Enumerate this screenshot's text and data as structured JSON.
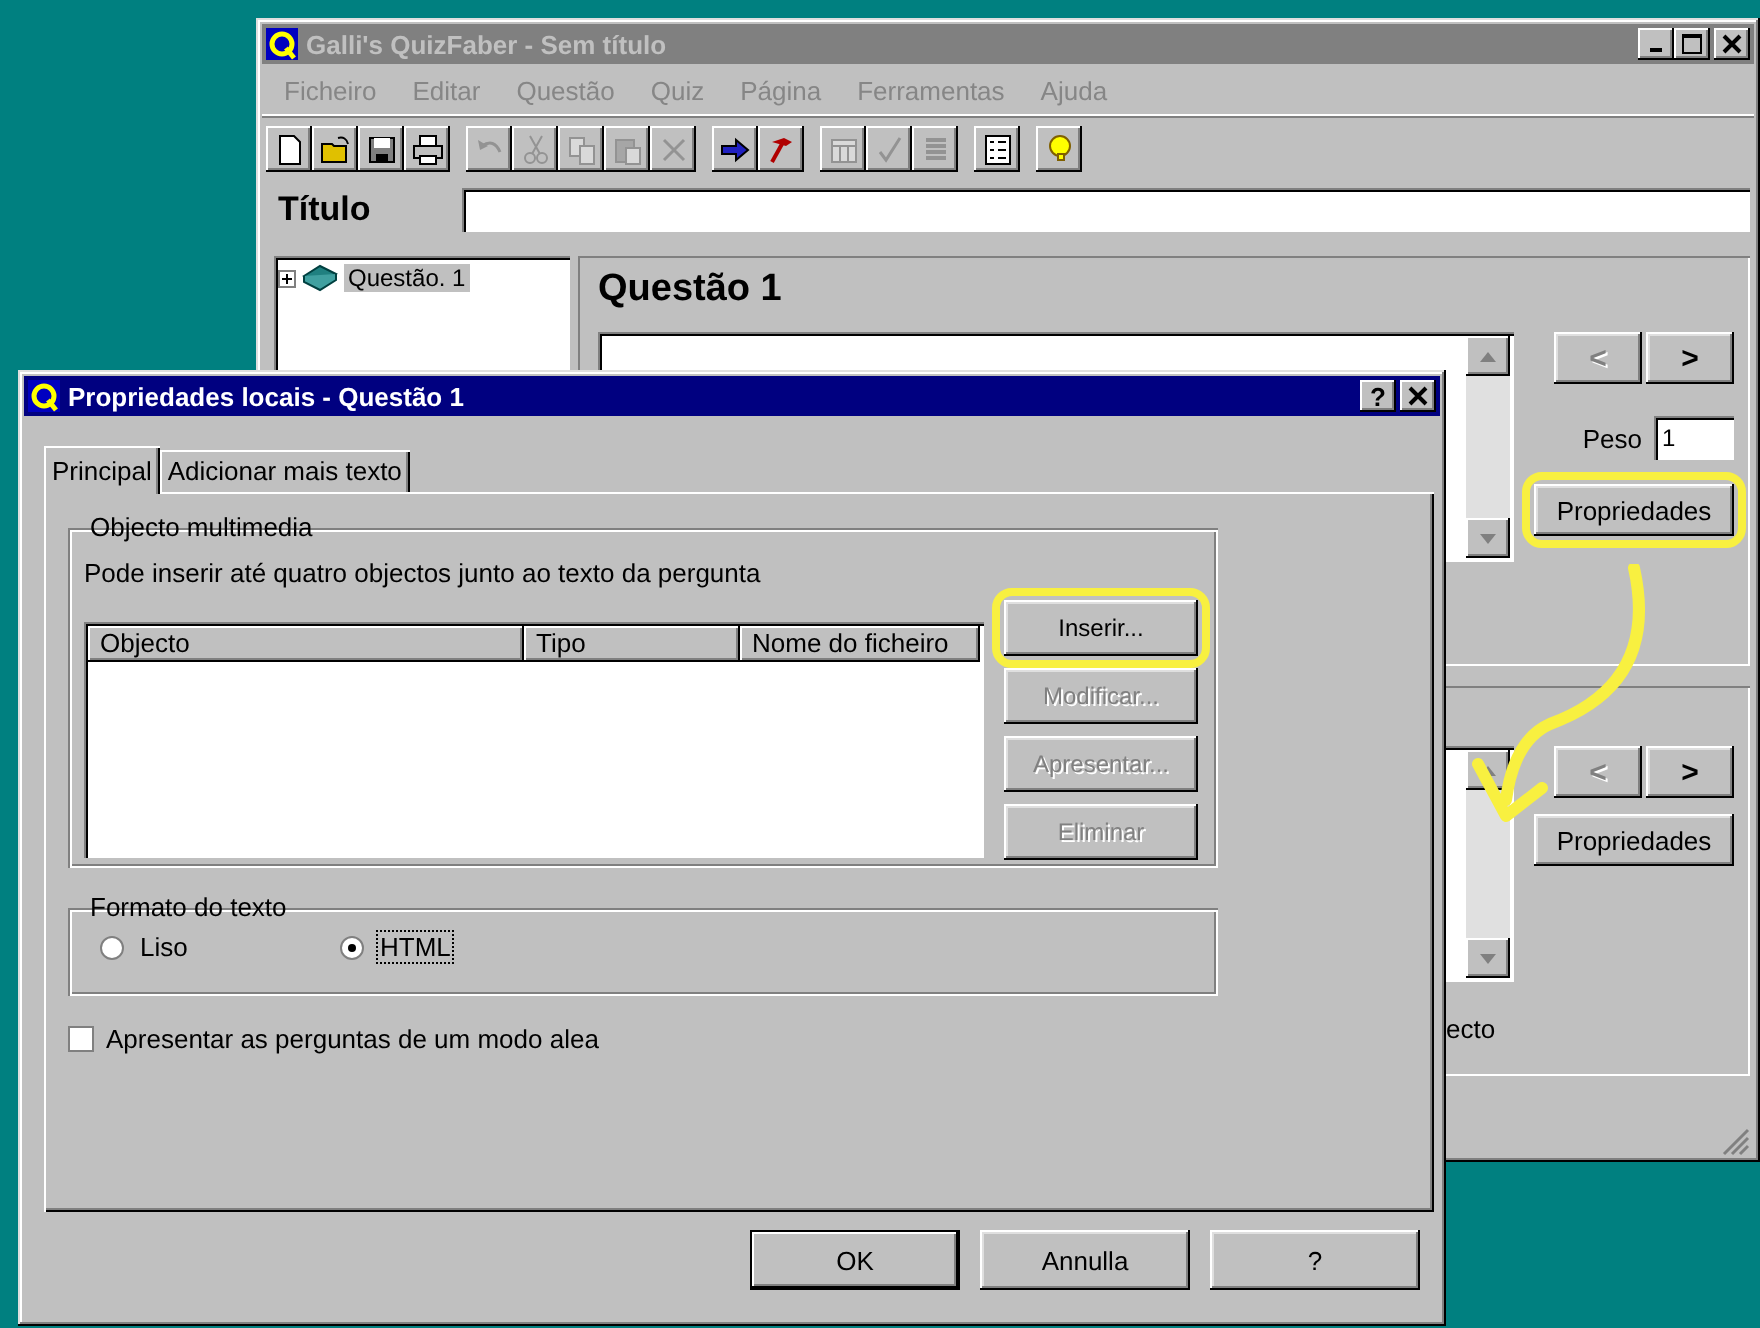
{
  "main_window": {
    "title": "Galli's QuizFaber - Sem título",
    "menu": [
      "Ficheiro",
      "Editar",
      "Questão",
      "Quiz",
      "Página",
      "Ferramentas",
      "Ajuda"
    ],
    "toolbar": [
      [
        {
          "disabled": false
        },
        {
          "disabled": false
        },
        {
          "disabled": false
        },
        {
          "disabled": false
        }
      ],
      [
        {
          "disabled": true
        },
        {
          "disabled": true
        },
        {
          "disabled": true
        },
        {
          "disabled": true
        },
        {
          "disabled": true
        }
      ],
      [
        {
          "disabled": false
        },
        {
          "disabled": false
        }
      ],
      [
        {
          "disabled": true
        },
        {
          "disabled": true
        },
        {
          "disabled": true
        }
      ],
      [
        {
          "disabled": false
        }
      ],
      [
        {
          "disabled": false
        }
      ]
    ],
    "title_label": "Título",
    "tree": [
      {
        "label": "Questão. 1",
        "selected": true,
        "expanded": false
      }
    ],
    "question_heading": "Questão 1",
    "nav_buttons": [
      {
        "label": "<",
        "disabled": true
      },
      {
        "label": ">",
        "disabled": false
      }
    ],
    "weight": {
      "label": "Peso",
      "value": "1"
    },
    "properties_button": {
      "label": "Propriedades",
      "highlighted": true
    },
    "lower_nav_buttons": [
      {
        "label": "<",
        "disabled": true
      },
      {
        "label": ">",
        "disabled": false
      }
    ],
    "lower_properties_button": {
      "label": "Propriedades",
      "highlighted": false
    },
    "lower_partial_text": "ecto"
  },
  "dialog": {
    "title": "Propriedades locais - Questão 1",
    "help_button": "?",
    "tabs": [
      {
        "label": "Principal",
        "selected": true
      },
      {
        "label": "Adicionar mais texto",
        "selected": false
      }
    ],
    "multimedia_group": {
      "legend": "Objecto multimedia",
      "hint": "Pode inserir até quatro objectos junto ao texto da pergunta",
      "columns": [
        "Objecto",
        "Tipo",
        "Nome do ficheiro"
      ],
      "buttons": [
        {
          "label": "Inserir...",
          "disabled": false,
          "highlighted": true
        },
        {
          "label": "Modificar...",
          "disabled": true,
          "highlighted": false
        },
        {
          "label": "Apresentar...",
          "disabled": true,
          "highlighted": false
        },
        {
          "label": "Eliminar",
          "disabled": true,
          "highlighted": false
        }
      ]
    },
    "format_group": {
      "legend": "Formato do texto",
      "options": [
        {
          "label": "Liso",
          "selected": false,
          "focused": false
        },
        {
          "label": "HTML",
          "selected": true,
          "focused": true
        }
      ]
    },
    "random_checkbox": {
      "label": "Apresentar as perguntas de um modo alea",
      "checked": false
    },
    "buttons": [
      {
        "label": "OK",
        "default": true
      },
      {
        "label": "Annulla",
        "default": false
      },
      {
        "label": "?",
        "default": false
      }
    ]
  }
}
